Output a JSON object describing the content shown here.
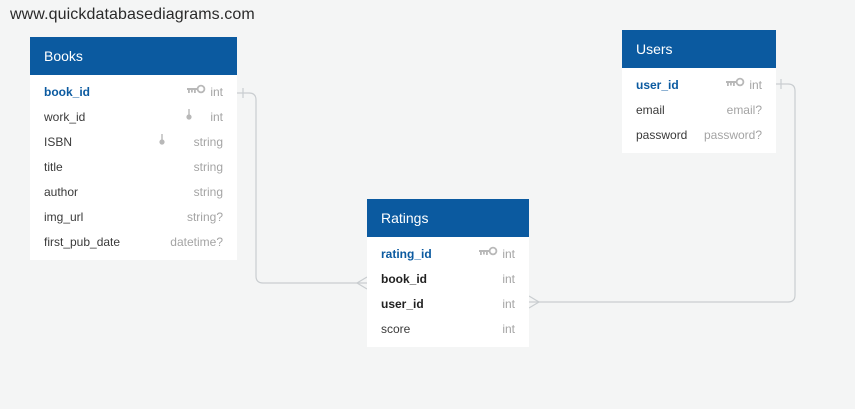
{
  "site": "www.quickdatabasediagrams.com",
  "icons": {
    "primary_key": "key-icon",
    "foreign_key": "pin-icon"
  },
  "colors": {
    "header": "#0b5aa0",
    "primary_key_text": "#0b5aa0",
    "type_text": "#a4a4a4",
    "connector": "#c9cdd0"
  },
  "tables": {
    "books": {
      "name": "Books",
      "fields": [
        {
          "name": "book_id",
          "type": "int"
        },
        {
          "name": "work_id",
          "type": "int"
        },
        {
          "name": "ISBN",
          "type": "string"
        },
        {
          "name": "title",
          "type": "string"
        },
        {
          "name": "author",
          "type": "string"
        },
        {
          "name": "img_url",
          "type": "string?"
        },
        {
          "name": "first_pub_date",
          "type": "datetime?"
        }
      ]
    },
    "users": {
      "name": "Users",
      "fields": [
        {
          "name": "user_id",
          "type": "int"
        },
        {
          "name": "email",
          "type": "email?"
        },
        {
          "name": "password",
          "type": "password?"
        }
      ]
    },
    "ratings": {
      "name": "Ratings",
      "fields": [
        {
          "name": "rating_id",
          "type": "int"
        },
        {
          "name": "book_id",
          "type": "int"
        },
        {
          "name": "user_id",
          "type": "int"
        },
        {
          "name": "score",
          "type": "int"
        }
      ]
    }
  },
  "relationships": [
    {
      "from": "Ratings.book_id",
      "to": "Books.book_id",
      "cardinality": "many-to-one"
    },
    {
      "from": "Ratings.user_id",
      "to": "Users.user_id",
      "cardinality": "many-to-one"
    }
  ]
}
